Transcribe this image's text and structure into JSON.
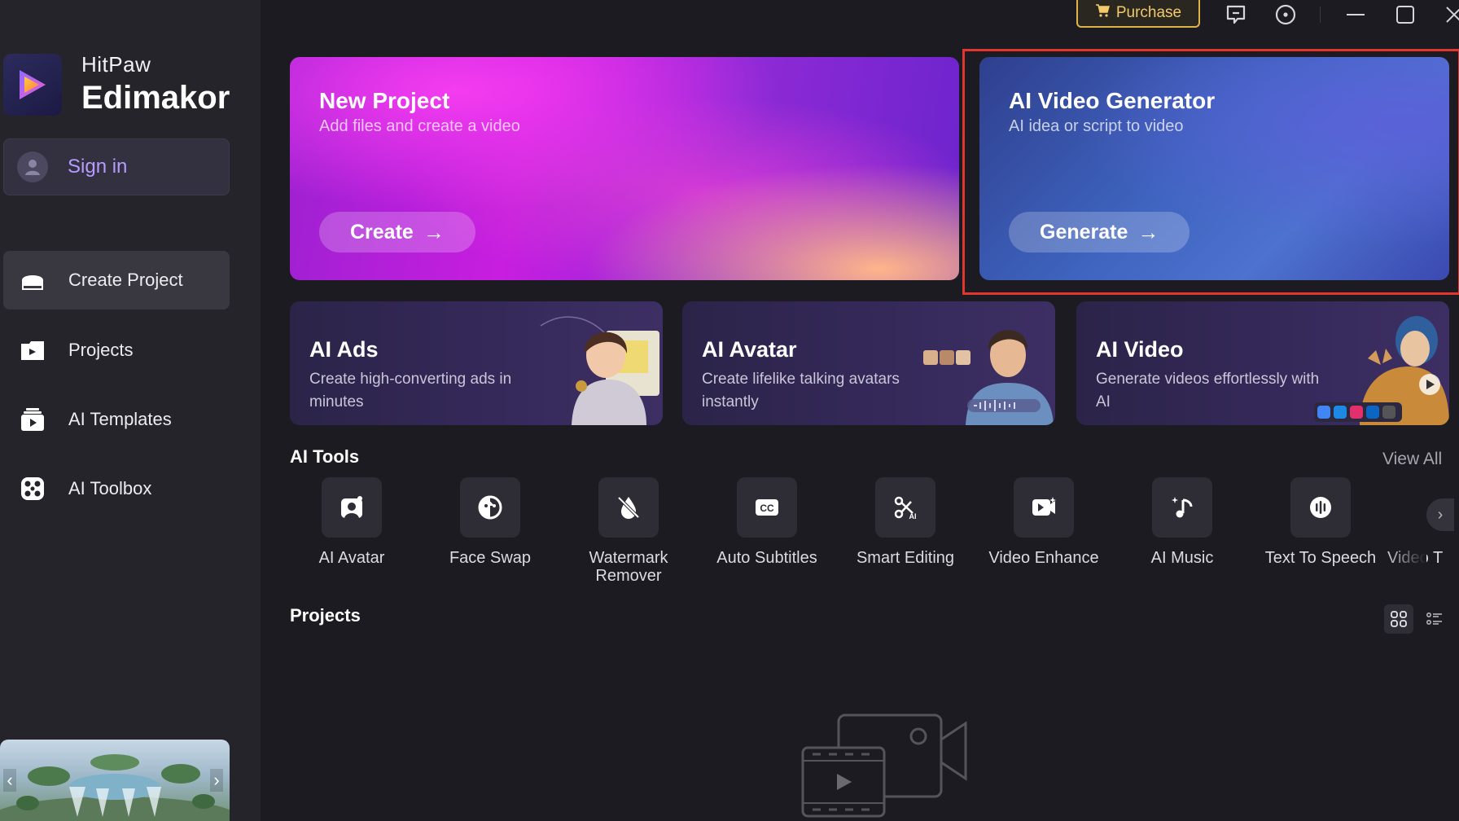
{
  "app": {
    "brand_sub": "HitPaw",
    "brand_main": "Edimakor",
    "accent_color": "#b79cff",
    "highlight_color": "#e2362f"
  },
  "titlebar": {
    "purchase_label": "Purchase"
  },
  "sidebar": {
    "sign_in": "Sign in",
    "items": [
      {
        "label": "Create Project",
        "icon": "home-icon",
        "active": true
      },
      {
        "label": "Projects",
        "icon": "folder-icon",
        "active": false
      },
      {
        "label": "AI Templates",
        "icon": "template-icon",
        "active": false
      },
      {
        "label": "AI Toolbox",
        "icon": "toolbox-icon",
        "active": false
      }
    ]
  },
  "hero": {
    "new_project": {
      "title": "New Project",
      "subtitle": "Add files and create a video",
      "button": "Create"
    },
    "ai_video_generator": {
      "title": "AI Video Generator",
      "subtitle": "AI idea or script to video",
      "button": "Generate"
    }
  },
  "features": [
    {
      "title": "AI Ads",
      "desc": "Create high-converting ads in minutes"
    },
    {
      "title": "AI Avatar",
      "desc": "Create lifelike talking avatars instantly"
    },
    {
      "title": "AI Video",
      "desc": "Generate videos effortlessly with AI"
    }
  ],
  "ai_tools": {
    "title": "AI Tools",
    "view_all": "View All",
    "items": [
      {
        "label": "AI Avatar",
        "icon": "avatar-icon"
      },
      {
        "label": "Face Swap",
        "icon": "face-swap-icon"
      },
      {
        "label": "Watermark Remover",
        "icon": "watermark-remover-icon"
      },
      {
        "label": "Auto Subtitles",
        "icon": "cc-icon"
      },
      {
        "label": "Smart Editing",
        "icon": "scissors-ai-icon"
      },
      {
        "label": "Video Enhance",
        "icon": "video-enhance-icon"
      },
      {
        "label": "AI Music",
        "icon": "music-icon"
      },
      {
        "label": "Text To Speech",
        "icon": "speech-icon"
      },
      {
        "label": "Video T",
        "icon": "video-icon"
      }
    ]
  },
  "projects": {
    "title": "Projects"
  }
}
